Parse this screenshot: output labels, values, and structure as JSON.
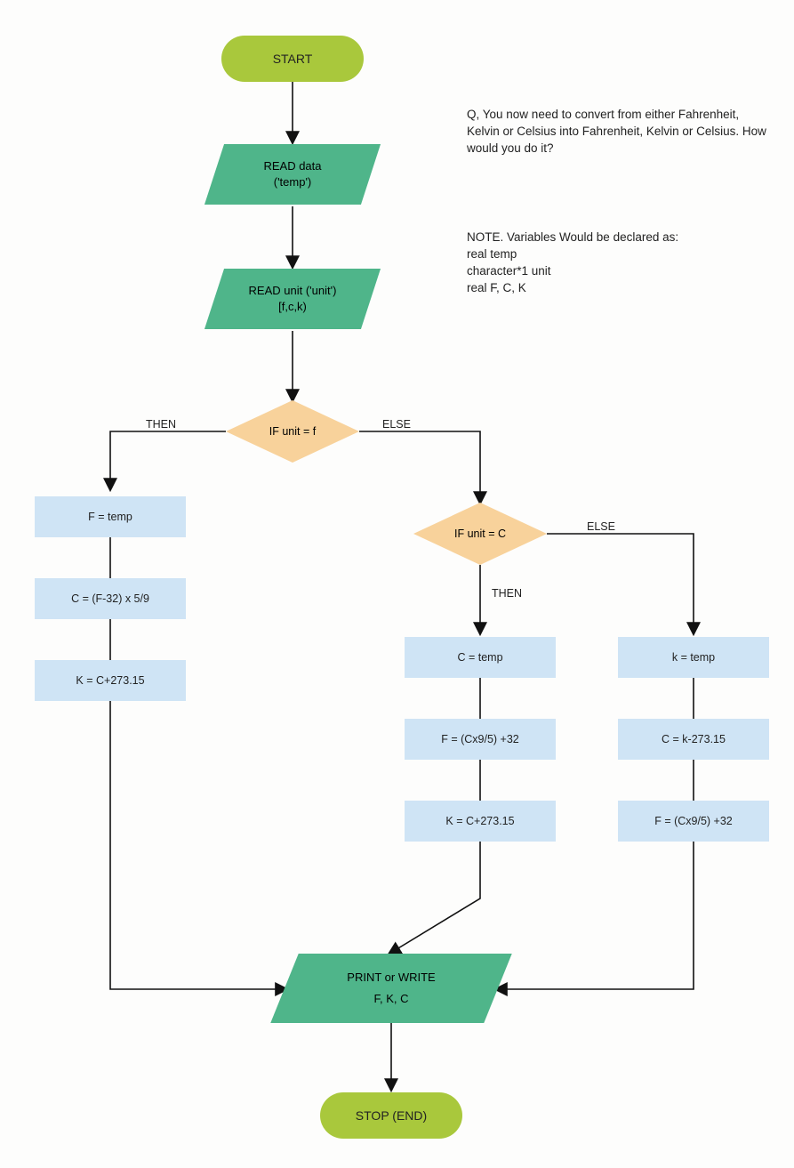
{
  "nodes": {
    "start": "START",
    "read_data_l1": "READ data",
    "read_data_l2": "('temp')",
    "read_unit_l1": "READ unit ('unit')",
    "read_unit_l2": "[f,c,k)",
    "if_unit_f": "IF unit = f",
    "if_unit_c": "IF unit = C",
    "f_eq_temp": "F = temp",
    "c_from_f": "C = (F-32) x 5/9",
    "k_from_c1": "K = C+273.15",
    "c_eq_temp": "C = temp",
    "f_from_c1": "F = (Cx9/5) +32",
    "k_from_c2": "K = C+273.15",
    "k_eq_temp": "k = temp",
    "c_from_k": "C = k-273.15",
    "f_from_c2": "F = (Cx9/5) +32",
    "print_l1": "PRINT or WRITE",
    "print_l2": "F, K, C",
    "stop": "STOP (END)"
  },
  "labels": {
    "then1": "THEN",
    "else1": "ELSE",
    "then2": "THEN",
    "else2": "ELSE"
  },
  "annotations": {
    "q": "Q, You now need to convert from either Fahrenheit, Kelvin or Celsius into Fahrenheit, Kelvin or Celsius. How would you do it?",
    "note_l1": "NOTE. Variables Would be declared as:",
    "note_l2": "real temp",
    "note_l3": "character*1 unit",
    "note_l4": "real F, C, K"
  },
  "colors": {
    "terminator": "#a9c83c",
    "io": "#4fb58a",
    "decision": "#f8d29b",
    "process": "#cfe4f5",
    "line": "#111"
  }
}
